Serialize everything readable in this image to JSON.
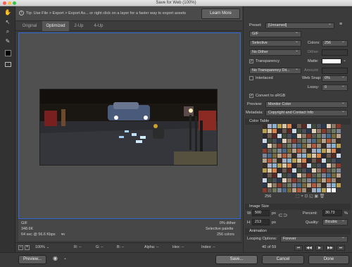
{
  "window": {
    "title": "Save for Web (100%)"
  },
  "tip": {
    "text": "Tip: Use File > Export > Export As... or right click on a layer for a faster way to export assets",
    "learn_more": "Learn More"
  },
  "tabs": [
    "Original",
    "Optimized",
    "2-Up",
    "4-Up"
  ],
  "info": {
    "format": "GIF",
    "size": "348.6K",
    "speed": "64 sec @ 56.6 Kbps",
    "dither": "0% dither",
    "palette": "Selective palette",
    "colors": "256 colors"
  },
  "status": {
    "zoom": "100%",
    "r": "R: --",
    "g": "G: --",
    "b": "B: --",
    "alpha": "Alpha: --",
    "hex": "Hex: --",
    "index": "Index: --"
  },
  "buttons": {
    "preview": "Preview...",
    "save": "Save...",
    "cancel": "Cancel",
    "done": "Done"
  },
  "panel": {
    "preset_label": "Preset:",
    "preset_value": "[Unnamed]",
    "format": "GIF",
    "reduction": "Selective",
    "colors_label": "Colors:",
    "colors_value": "256",
    "dither": "No Dither",
    "dither_label": "Dither:",
    "transparency": "Transparency",
    "matte_label": "Matte:",
    "transparency_dither": "No Transparency Dit...",
    "amount_label": "Amount:",
    "interlaced": "Interlaced",
    "websnap_label": "Web Snap:",
    "websnap_value": "0%",
    "lossy_label": "Lossy:",
    "lossy_value": "0",
    "convert_srgb": "Convert to sRGB",
    "preview_label": "Preview:",
    "preview_value": "Monitor Color",
    "metadata_label": "Metadata:",
    "metadata_value": "Copyright and Contact Info",
    "color_table": "Color Table",
    "color_count": "256",
    "image_size": "Image Size",
    "w_label": "W:",
    "w_value": "500",
    "h_label": "H:",
    "h_value": "213",
    "px": "px",
    "percent_label": "Percent:",
    "percent_value": "30.73",
    "percent_unit": "%",
    "quality_label": "Quality:",
    "quality_value": "Bicubic",
    "animation": "Animation",
    "looping_label": "Looping Options:",
    "looping_value": "Forever",
    "frame": "40 of 59"
  },
  "colors": {
    "accent": "#2e6bd8",
    "canvas_bg": "#505050"
  }
}
